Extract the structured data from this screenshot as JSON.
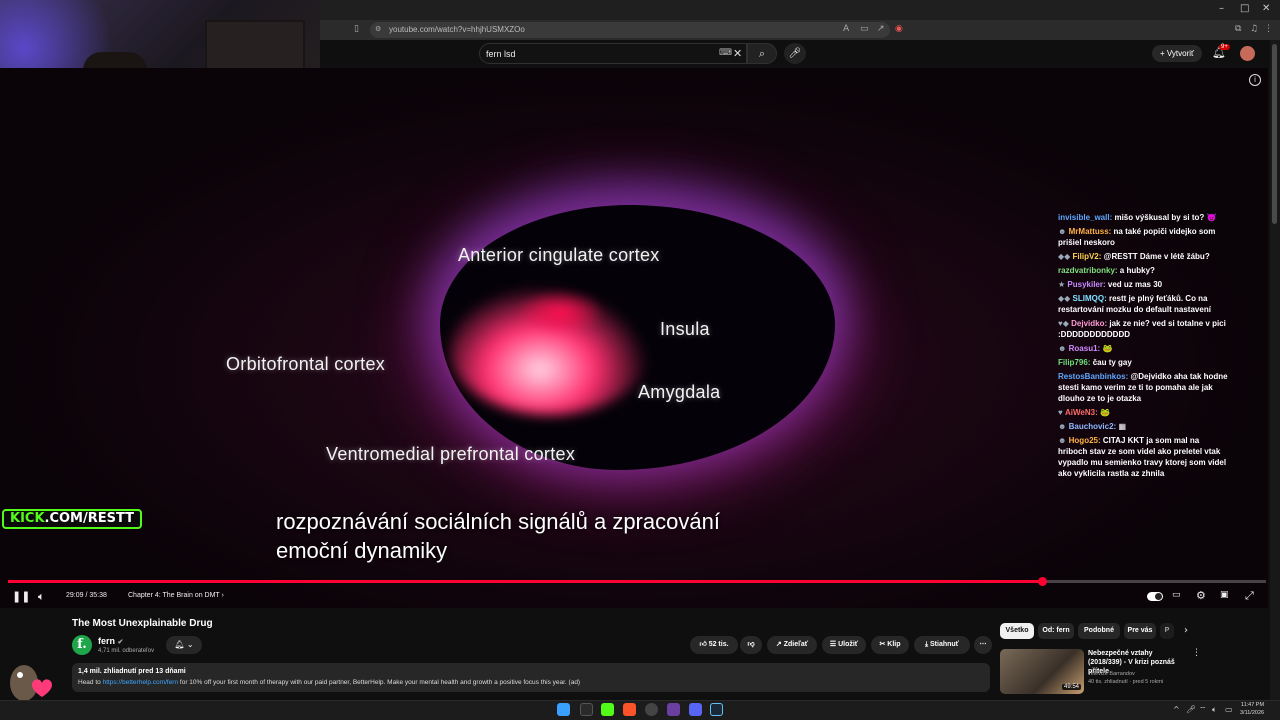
{
  "browser": {
    "url": "youtube.com/watch?v=hhjhUSMXZOo",
    "window_controls": [
      "–",
      "□",
      "✕"
    ]
  },
  "youtube_header": {
    "search_value": "fern lsd",
    "create_label": "Vytvoriť",
    "notifications_badge": "9+"
  },
  "overlay": {
    "kick_prefix": "KICK",
    "kick_rest": ".COM/RESTT"
  },
  "video": {
    "labels": {
      "acc": "Anterior cingulate cortex",
      "insula": "Insula",
      "ofc": "Orbitofrontal cortex",
      "amygdala": "Amygdala",
      "vmpfc": "Ventromedial prefrontal cortex"
    },
    "subtitle_line1": "rozpoznávání sociálních signálů a zpracování",
    "subtitle_line2": "emoční dynamiky",
    "progress_fraction": 0.822
  },
  "chat": [
    {
      "badge": "",
      "user": "invisible_wall:",
      "color": "#5fa8ff",
      "msg": "mišo výškusal by si to?",
      "emoji": "😈"
    },
    {
      "badge": "☻",
      "user": "MrMattuss:",
      "color": "#ffb347",
      "msg": "na také popiči videjko som prišiel neskoro",
      "emoji": ""
    },
    {
      "badge": "◆◆",
      "user": "FilipV2:",
      "color": "#ffd34d",
      "msg": "@RESTT Dáme v létě žábu?",
      "emoji": ""
    },
    {
      "badge": "",
      "user": "razdvatribonky:",
      "color": "#7ee07e",
      "msg": "a hubky?",
      "emoji": ""
    },
    {
      "badge": "★",
      "user": "Pusykiler:",
      "color": "#c78bff",
      "msg": "ved uz mas 30",
      "emoji": ""
    },
    {
      "badge": "◆◆",
      "user": "SLIMQQ:",
      "color": "#7fe0ff",
      "msg": "restt je plný feťáků. Co na restartování mozku do default nastavení",
      "emoji": ""
    },
    {
      "badge": "♥◆",
      "user": "Dejvidko:",
      "color": "#ff9ad5",
      "msg": "jak ze nie? ved si totalne v pici :DDDDDDDDDDDD",
      "emoji": ""
    },
    {
      "badge": "☻",
      "user": "Roasu1:",
      "color": "#d08bff",
      "msg": "",
      "emoji": "🐸"
    },
    {
      "badge": "",
      "user": "Filip796:",
      "color": "#6fe07a",
      "msg": "čau ty gay",
      "emoji": ""
    },
    {
      "badge": "",
      "user": "RestosBanbinkos:",
      "color": "#5fa8ff",
      "msg": "@Dejvidko aha tak hodne stesti kamo verim ze ti to pomaha ale jak dlouho ze to je otazka",
      "emoji": ""
    },
    {
      "badge": "♥",
      "user": "AiWeN3:",
      "color": "#ff6b6b",
      "msg": "",
      "emoji": "🐸"
    },
    {
      "badge": "☻",
      "user": "Bauchovic2:",
      "color": "#8fb8ff",
      "msg": "",
      "emoji": "▦"
    },
    {
      "badge": "☻",
      "user": "Hogo25:",
      "color": "#ffb347",
      "msg": "CITAJ KKT ja som mal na hriboch stav ze som videl ako preletel vtak vypadlo mu semienko travy ktorej som videl ako vyklicila rastla az zhnila",
      "emoji": ""
    }
  ],
  "player": {
    "time": "29:09 / 35:38",
    "chapter": "Chapter 4: The Brain on DMT"
  },
  "details": {
    "title": "The Most Unexplainable Drug",
    "channel": "fern",
    "channel_initial": "f.",
    "subscribers": "4,71 mil. odberateľov",
    "likes": "52 tis.",
    "share": "Zdieľať",
    "save": "Uložiť",
    "clip": "Klip",
    "download": "Stiahnuť",
    "stats": "1,4 mil. zhliadnutí  pred 13 dňami",
    "desc_prefix": "Head to ",
    "desc_link": "https://betterhelp.com/fern",
    "desc_suffix": " for 10% off your first month of therapy with our paid partner, BetterHelp. Make your mental health and growth a positive focus this year. (ad)"
  },
  "chips": [
    "Všetko",
    "Od: fern",
    "Podobné",
    "Pre vás",
    "P"
  ],
  "recommended": {
    "title": "Nebezpečné vztahy (2018/339) - V krizi poznáš přítele",
    "channel": "Televize Barrandov",
    "meta": "40 tis. zhliadnutí · pred 5 rokmi",
    "duration": "49:54"
  },
  "taskbar": {
    "time": "11:47 PM",
    "date": "3/11/2026"
  },
  "colors": {
    "accent_red": "#ff0033",
    "kick_green": "#53fc18",
    "channel_green": "#1fa64a"
  }
}
